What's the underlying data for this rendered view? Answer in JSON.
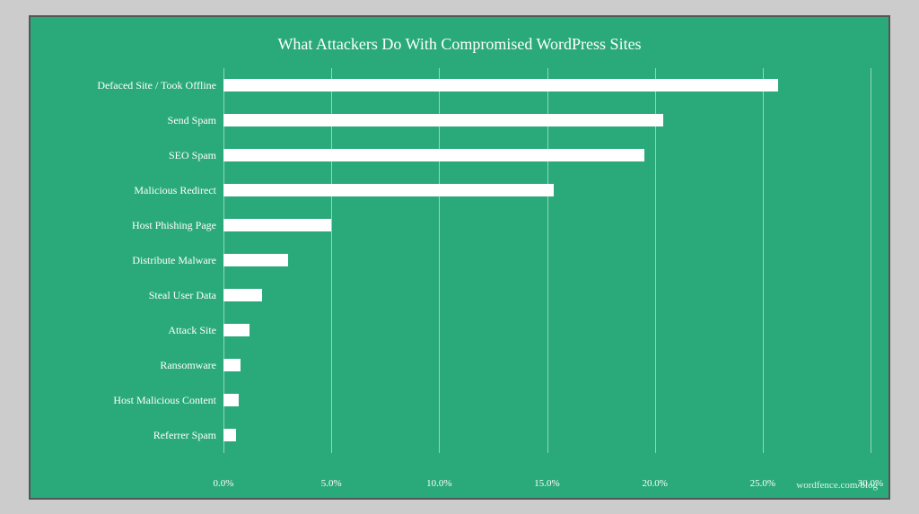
{
  "chart": {
    "title": "What Attackers Do With Compromised WordPress Sites",
    "watermark": "wordfence.com/blog",
    "maxValue": 30,
    "bars": [
      {
        "label": "Defaced Site / Took Offline",
        "value": 25.7
      },
      {
        "label": "Send Spam",
        "value": 20.4
      },
      {
        "label": "SEO Spam",
        "value": 19.5
      },
      {
        "label": "Malicious Redirect",
        "value": 15.3
      },
      {
        "label": "Host Phishing Page",
        "value": 5.0
      },
      {
        "label": "Distribute Malware",
        "value": 3.0
      },
      {
        "label": "Steal User Data",
        "value": 1.8
      },
      {
        "label": "Attack Site",
        "value": 1.2
      },
      {
        "label": "Ransomware",
        "value": 0.8
      },
      {
        "label": "Host Malicious Content",
        "value": 0.7
      },
      {
        "label": "Referrer Spam",
        "value": 0.6
      }
    ],
    "xTicks": [
      {
        "label": "0.0%",
        "pct": 0
      },
      {
        "label": "5.0%",
        "pct": 16.667
      },
      {
        "label": "10.0%",
        "pct": 33.333
      },
      {
        "label": "15.0%",
        "pct": 50.0
      },
      {
        "label": "20.0%",
        "pct": 66.667
      },
      {
        "label": "25.0%",
        "pct": 83.333
      },
      {
        "label": "30.0%",
        "pct": 100.0
      }
    ]
  }
}
